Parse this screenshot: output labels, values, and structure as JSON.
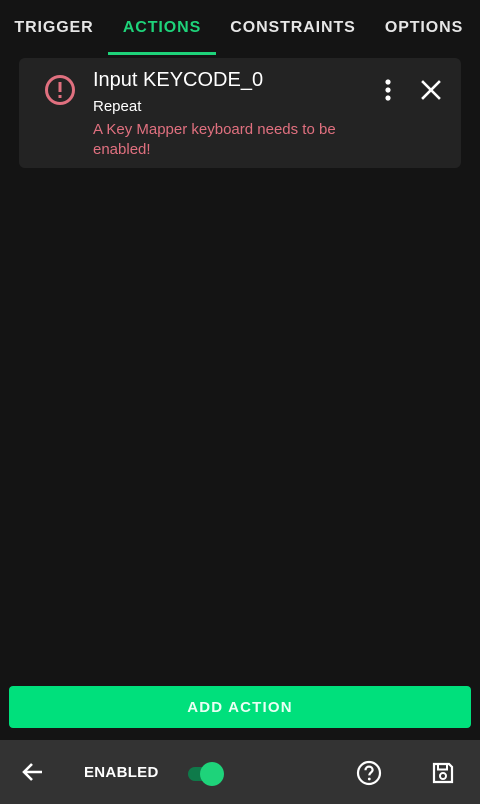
{
  "tabs": [
    {
      "label": "TRIGGER",
      "active": false
    },
    {
      "label": "ACTIONS",
      "active": true
    },
    {
      "label": "CONSTRAINTS",
      "active": false
    },
    {
      "label": "OPTIONS",
      "active": false
    }
  ],
  "action_card": {
    "title": "Input KEYCODE_0",
    "subtitle": "Repeat",
    "error": "A Key Mapper keyboard needs to be enabled!",
    "icons": {
      "status": "error-icon",
      "menu": "more-vert-icon",
      "remove": "close-icon"
    }
  },
  "add_action_label": "ADD ACTION",
  "bottom_bar": {
    "enabled_label": "ENABLED",
    "enabled_on": true,
    "icons": {
      "back": "arrow-back-icon",
      "help": "help-icon",
      "save": "save-icon"
    }
  },
  "colors": {
    "accent": "#1ed37a",
    "button": "#00e07c",
    "error": "#e0707f",
    "background": "#141414",
    "card": "#232323",
    "bottom_bar": "#333333"
  }
}
